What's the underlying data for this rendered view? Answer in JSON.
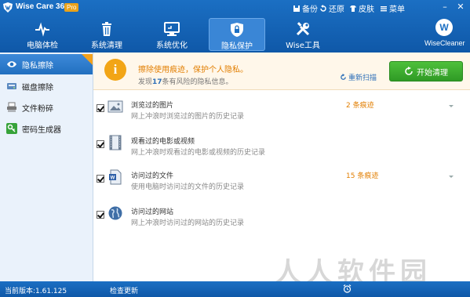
{
  "app": {
    "name": "Wise Care 365",
    "badge": "Pro"
  },
  "title_menu": [
    {
      "label": "备份",
      "icon": "disk-icon"
    },
    {
      "label": "还原",
      "icon": "restore-icon"
    },
    {
      "label": "皮肤",
      "icon": "shirt-icon"
    },
    {
      "label": "菜单",
      "icon": "menu-icon"
    }
  ],
  "window_controls": {
    "minimize": "–",
    "close": "✕"
  },
  "tabs": [
    {
      "label": "电脑体检",
      "icon": "pulse-icon"
    },
    {
      "label": "系统清理",
      "icon": "trash-icon"
    },
    {
      "label": "系统优化",
      "icon": "monitor-icon"
    },
    {
      "label": "隐私保护",
      "icon": "shield-icon",
      "active": true
    },
    {
      "label": "Wise工具",
      "icon": "tools-icon"
    }
  ],
  "brand": {
    "logo_letter": "W",
    "name": "WiseCleaner"
  },
  "sidebar": {
    "items": [
      {
        "label": "隐私擦除",
        "icon": "eye-icon",
        "active": true
      },
      {
        "label": "磁盘擦除",
        "icon": "disk-erase-icon"
      },
      {
        "label": "文件粉碎",
        "icon": "shredder-icon"
      },
      {
        "label": "密码生成器",
        "icon": "key-icon"
      }
    ]
  },
  "banner": {
    "icon_text": "i",
    "title": "擦除使用痕迹，保护个人隐私。",
    "sub_prefix": "发现",
    "sub_count": "17",
    "sub_suffix": "条有风险的隐私信息。",
    "rescan": "重新扫描",
    "clean_button": "开始清理"
  },
  "items": [
    {
      "title": "浏览过的图片",
      "desc": "网上冲浪时浏览过的图片的历史记录",
      "count": "2 条痕迹",
      "icon": "picture-icon"
    },
    {
      "title": "观看过的电影或视频",
      "desc": "网上冲浪时观看过的电影或视频的历史记录",
      "count": "",
      "icon": "film-icon"
    },
    {
      "title": "访问过的文件",
      "desc": "使用电脑时访问过的文件的历史记录",
      "count": "15 条痕迹",
      "icon": "document-icon"
    },
    {
      "title": "访问过的网站",
      "desc": "网上冲浪时访问过的网站的历史记录",
      "count": "",
      "icon": "globe-icon"
    }
  ],
  "status": {
    "version": "当前版本:1.61.125",
    "update": "检查更新"
  },
  "watermark": "人人软件园",
  "colors": {
    "nav": "#1b6fc3",
    "accent_orange": "#e27e00",
    "green_button": "#3aab2e"
  }
}
